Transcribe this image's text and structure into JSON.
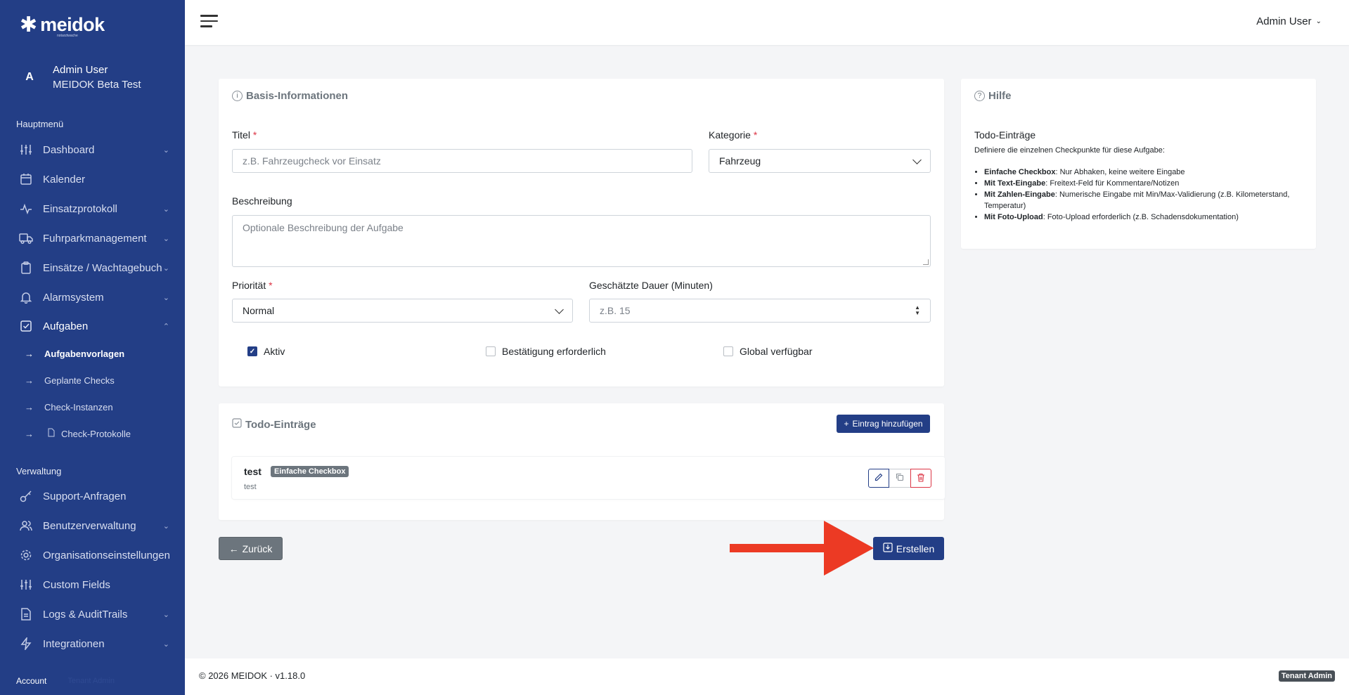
{
  "brand": {
    "name": "meidok",
    "tagline": "notarztwache"
  },
  "user": {
    "initial": "A",
    "name": "Admin User",
    "org": "MEIDOK Beta Test"
  },
  "sidebar": {
    "main_label": "Hauptmenü",
    "items": [
      {
        "label": "Dashboard",
        "icon": "sliders-icon",
        "chevron": "⌄"
      },
      {
        "label": "Kalender",
        "icon": "calendar-icon",
        "chevron": ""
      },
      {
        "label": "Einsatzprotokoll",
        "icon": "pulse-icon",
        "chevron": "⌄"
      },
      {
        "label": "Fuhrparkmanagement",
        "icon": "truck-icon",
        "chevron": "⌄"
      },
      {
        "label": "Einsätze / Wachtagebuch",
        "icon": "clipboard-icon",
        "chevron": "⌄"
      },
      {
        "label": "Alarmsystem",
        "icon": "bell-icon",
        "chevron": "⌄"
      },
      {
        "label": "Aufgaben",
        "icon": "check-square-icon",
        "chevron": "⌃"
      }
    ],
    "sub_items": [
      {
        "label": "Aufgabenvorlagen",
        "arrow": "→"
      },
      {
        "label": "Geplante Checks",
        "arrow": "→"
      },
      {
        "label": "Check-Instanzen",
        "arrow": "→"
      },
      {
        "label": "Check-Protokolle",
        "arrow": "→"
      }
    ],
    "admin_label": "Verwaltung",
    "admin_items": [
      {
        "label": "Support-Anfragen",
        "icon": "key-icon",
        "chevron": ""
      },
      {
        "label": "Benutzerverwaltung",
        "icon": "users-icon",
        "chevron": "⌄"
      },
      {
        "label": "Organisationseinstellungen",
        "icon": "gear-icon",
        "chevron": ""
      },
      {
        "label": "Custom Fields",
        "icon": "sliders-icon",
        "chevron": ""
      },
      {
        "label": "Logs & AuditTrails",
        "icon": "document-icon",
        "chevron": "⌄"
      },
      {
        "label": "Integrationen",
        "icon": "bolt-icon",
        "chevron": "⌄"
      }
    ],
    "account_label": "Account",
    "account_extra": "Tenant Admin"
  },
  "topbar": {
    "user_label": "Admin User",
    "chevron": "⌄"
  },
  "basis": {
    "title": "Basis-Informationen",
    "title_label": "Titel",
    "title_placeholder": "z.B. Fahrzeugcheck vor Einsatz",
    "category_label": "Kategorie",
    "category_value": "Fahrzeug",
    "description_label": "Beschreibung",
    "description_placeholder": "Optionale Beschreibung der Aufgabe",
    "priority_label": "Priorität",
    "priority_value": "Normal",
    "duration_label": "Geschätzte Dauer (Minuten)",
    "duration_placeholder": "z.B. 15",
    "required_mark": "*",
    "checkboxes": [
      {
        "label": "Aktiv",
        "checked": true
      },
      {
        "label": "Bestätigung erforderlich",
        "checked": false
      },
      {
        "label": "Global verfügbar",
        "checked": false
      }
    ]
  },
  "todos": {
    "title": "Todo-Einträge",
    "add_button": "Eintrag hinzufügen",
    "items": [
      {
        "name": "test",
        "type": "Einfache Checkbox",
        "description": "test"
      }
    ]
  },
  "help": {
    "title": "Hilfe",
    "heading": "Todo-Einträge",
    "intro": "Definiere die einzelnen Checkpunkte für diese Aufgabe:",
    "items": [
      {
        "term": "Einfache Checkbox",
        "text": ": Nur Abhaken, keine weitere Eingabe"
      },
      {
        "term": "Mit Text-Eingabe",
        "text": ": Freitext-Feld für Kommentare/Notizen"
      },
      {
        "term": "Mit Zahlen-Eingabe",
        "text": ": Numerische Eingabe mit Min/Max-Validierung (z.B. Kilometerstand, Temperatur)"
      },
      {
        "term": "Mit Foto-Upload",
        "text": ": Foto-Upload erforderlich (z.B. Schadensdokumentation)"
      }
    ]
  },
  "actions": {
    "back": "Zurück",
    "create": "Erstellen"
  },
  "footer": {
    "copyright": "© 2026 MEIDOK · v1.18.0",
    "role_badge": "Tenant Admin"
  },
  "colors": {
    "brand": "#233e86",
    "danger": "#dc3545",
    "annotation": "#ec3a24"
  }
}
